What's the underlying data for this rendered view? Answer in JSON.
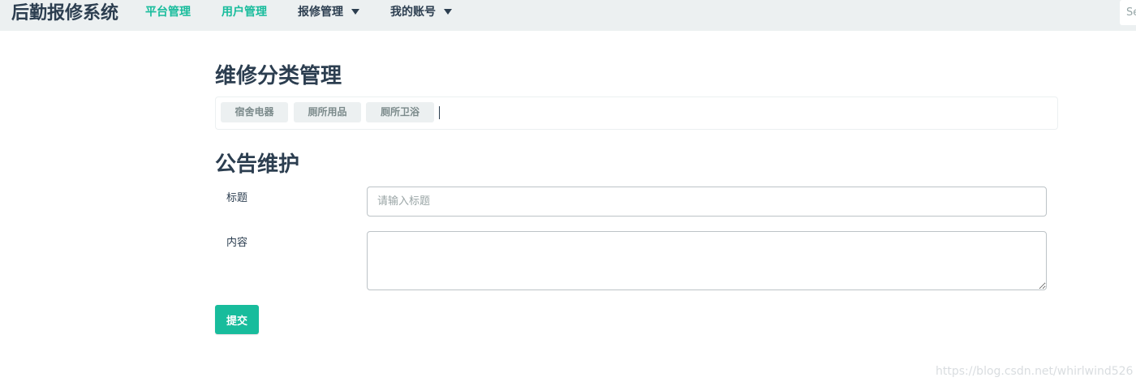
{
  "nav": {
    "brand": "后勤报修系统",
    "items": [
      {
        "label": "平台管理"
      },
      {
        "label": "用户管理"
      },
      {
        "label": "报修管理"
      },
      {
        "label": "我的账号"
      }
    ],
    "search_placeholder": "Search"
  },
  "categories": {
    "heading": "维修分类管理",
    "tags": [
      "宿舍电器",
      "厕所用品",
      "厕所卫浴"
    ]
  },
  "notice": {
    "heading": "公告维护",
    "title_label": "标题",
    "title_placeholder": "请输入标题",
    "content_label": "内容",
    "content_value": "",
    "submit_label": "提交"
  },
  "watermark": "https://blog.csdn.net/whirlwind526",
  "colors": {
    "accent": "#18bc9c",
    "navbar_bg": "#ecf0f1",
    "text_dark": "#2c3e50"
  }
}
